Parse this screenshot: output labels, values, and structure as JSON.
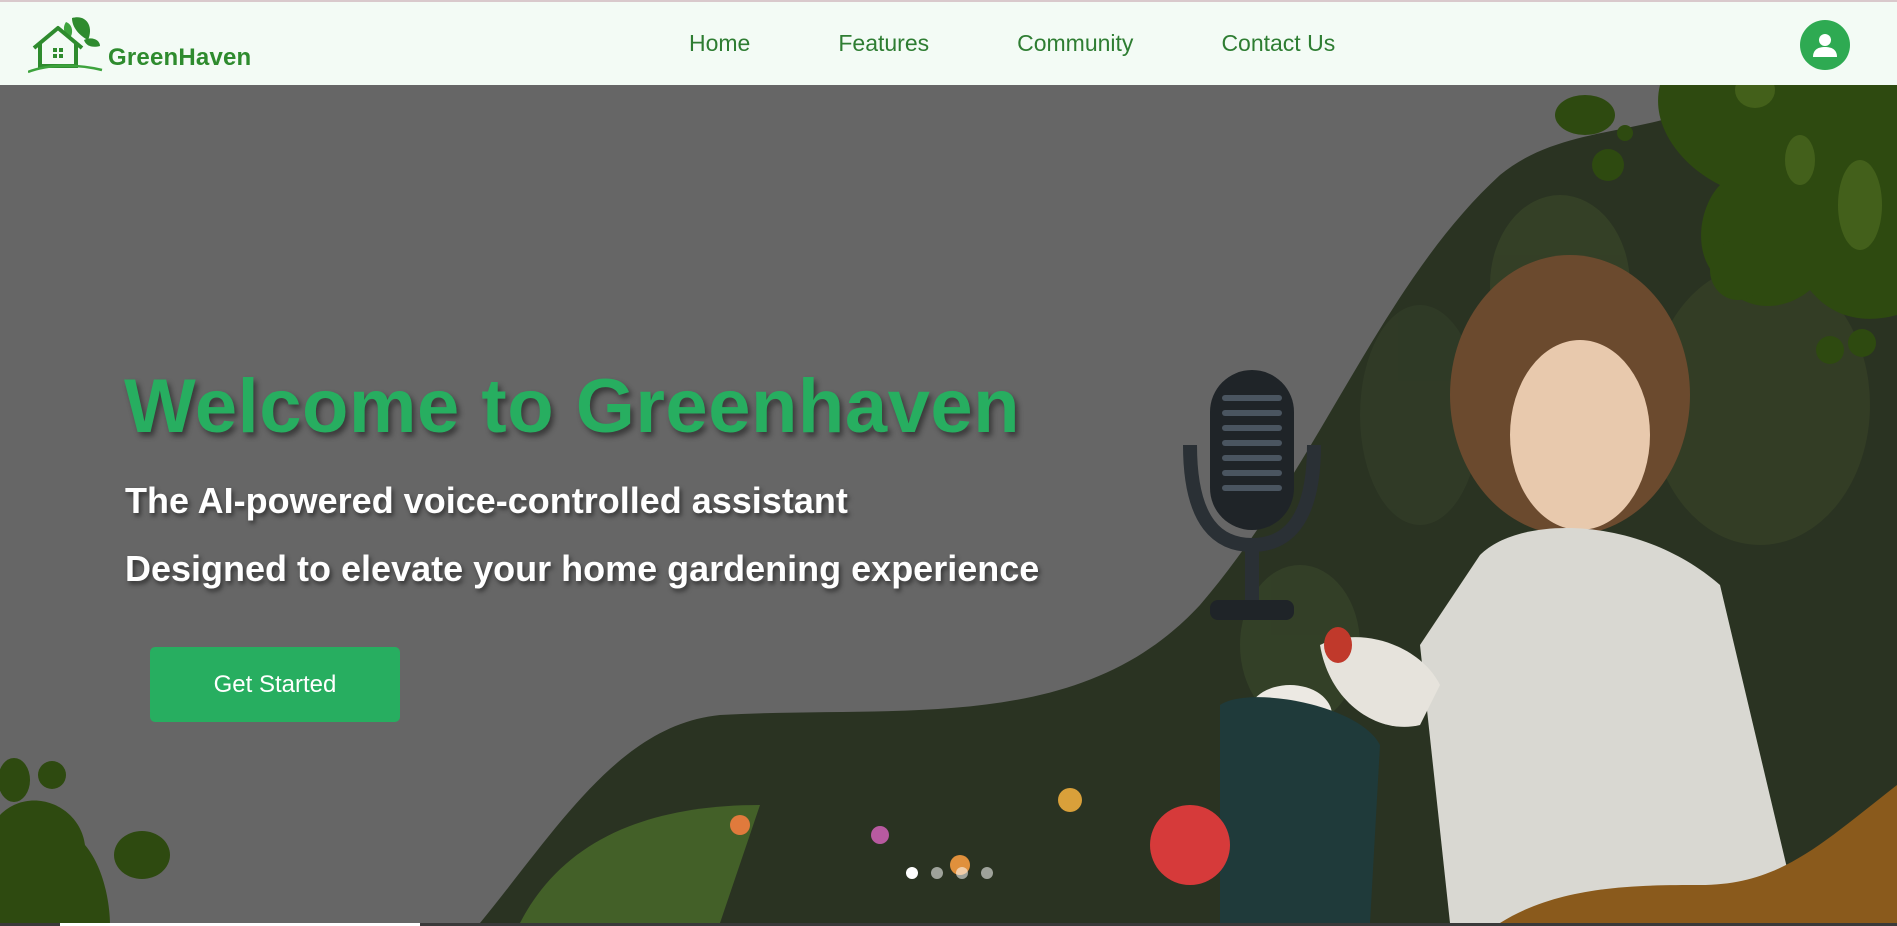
{
  "brand": {
    "name": "GreenHaven",
    "logo_icon": "house-leaf-logo"
  },
  "nav": {
    "items": [
      {
        "label": "Home"
      },
      {
        "label": "Features"
      },
      {
        "label": "Community"
      },
      {
        "label": "Contact Us"
      }
    ],
    "profile_icon": "user-profile-icon"
  },
  "hero": {
    "title": "Welcome to Greenhaven",
    "subtitle_1": "The AI-powered voice-controlled assistant",
    "subtitle_2": "Designed to elevate your home gardening experience",
    "cta_label": "Get Started",
    "illustration_icons": [
      "microphone-icon",
      "gardening-photo"
    ],
    "carousel": {
      "slide_count": 4,
      "active_slide": 1
    }
  },
  "colors": {
    "brand_green": "#27ae60",
    "nav_text": "#2e7d32",
    "header_bg": "#f3fbf5",
    "hero_overlay": "#666666",
    "leaf_dark": "#2f4a12",
    "accent_brown": "#8a5a1c"
  }
}
